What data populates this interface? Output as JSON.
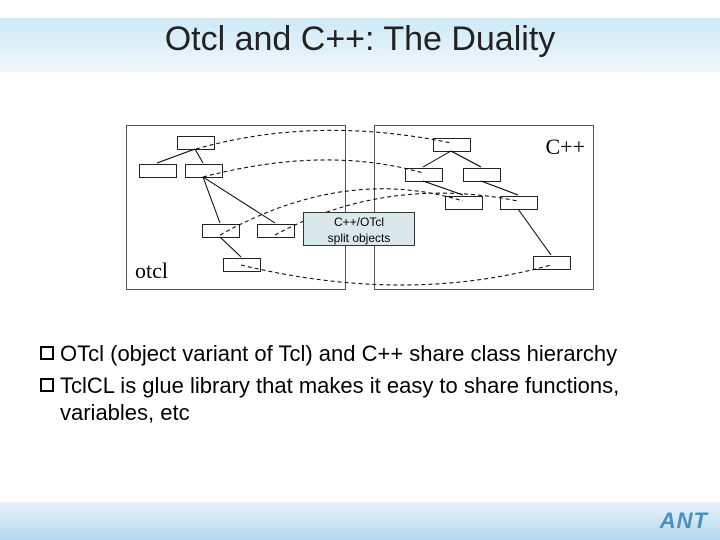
{
  "title": "Otcl and C++: The Duality",
  "diagram": {
    "label_cpp": "C++",
    "label_otcl": "otcl",
    "midbox_line1": "C++/OTcl",
    "midbox_line2": "split objects"
  },
  "bullets": [
    "OTcl (object variant of Tcl) and C++ share class hierarchy",
    "TclCL is glue library that makes it easy to share functions, variables, etc"
  ],
  "footer_logo": "ANT"
}
